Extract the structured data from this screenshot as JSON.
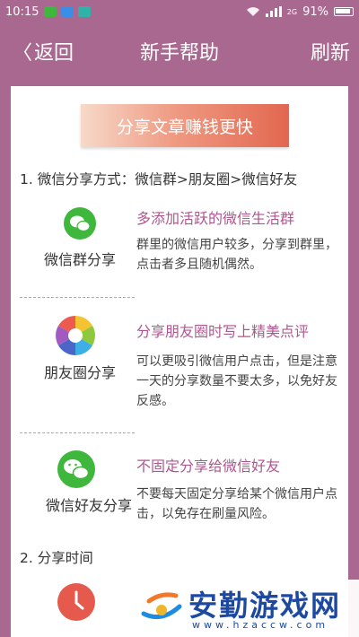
{
  "status_bar": {
    "time": "10:15",
    "battery": "91%",
    "network": "2G"
  },
  "nav": {
    "back_label": "返回",
    "title": "新手帮助",
    "refresh_label": "刷新"
  },
  "banner": "分享文章赚钱更快",
  "section1_title": "1. 微信分享方式：微信群>朋友圈>微信好友",
  "items": [
    {
      "label": "微信群分享",
      "heading": "多添加活跃的微信生活群",
      "desc": "群里的微信用户较多，分享到群里，点击者多且随机偶然。",
      "icon": "wechat-group-icon"
    },
    {
      "label": "朋友圈分享",
      "heading": "分享朋友圈时写上精美点评",
      "desc": "可以更吸引微信用户点击，但是注意一天的分享数量不要太多，以免好友反感。",
      "icon": "moments-icon"
    },
    {
      "label": "微信好友分享",
      "heading": "不固定分享给微信好友",
      "desc": "不要每天固定分享给某个微信用户点击，以免存在刷量风险。",
      "icon": "wechat-icon"
    }
  ],
  "section2_title": "2. 分享时间",
  "watermark": {
    "text": "安勤游戏网",
    "url": "www.hzaccw.com"
  },
  "colors": {
    "theme": "#a8688f",
    "heading": "#b0568f",
    "wechat_green": "#3fb73c",
    "clock_red": "#e55a4c"
  }
}
